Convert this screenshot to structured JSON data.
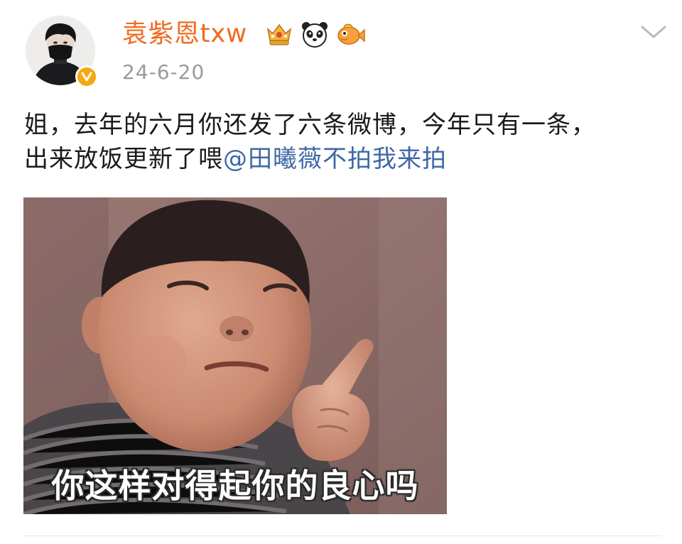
{
  "post": {
    "author": {
      "name": "袁紫恩txw",
      "verified": true,
      "avatar_icon": "avatar-masked-person",
      "badges": [
        "crown-badge-icon",
        "panda-badge-icon",
        "fish-badge-icon"
      ]
    },
    "timestamp": "24-6-20",
    "text_line1": "姐，去年的六月你还发了六条微博，今年只有一条，",
    "text_line2_prefix": "出来放饭更新了喂",
    "mention": "@田曦薇不拍我来拍",
    "image": {
      "caption": "你这样对得起你的良心吗"
    }
  },
  "colors": {
    "username": "#f26b22",
    "mention": "#3e68a5",
    "verified_badge": "#f7a70f",
    "timestamp": "#9a9a9a"
  }
}
